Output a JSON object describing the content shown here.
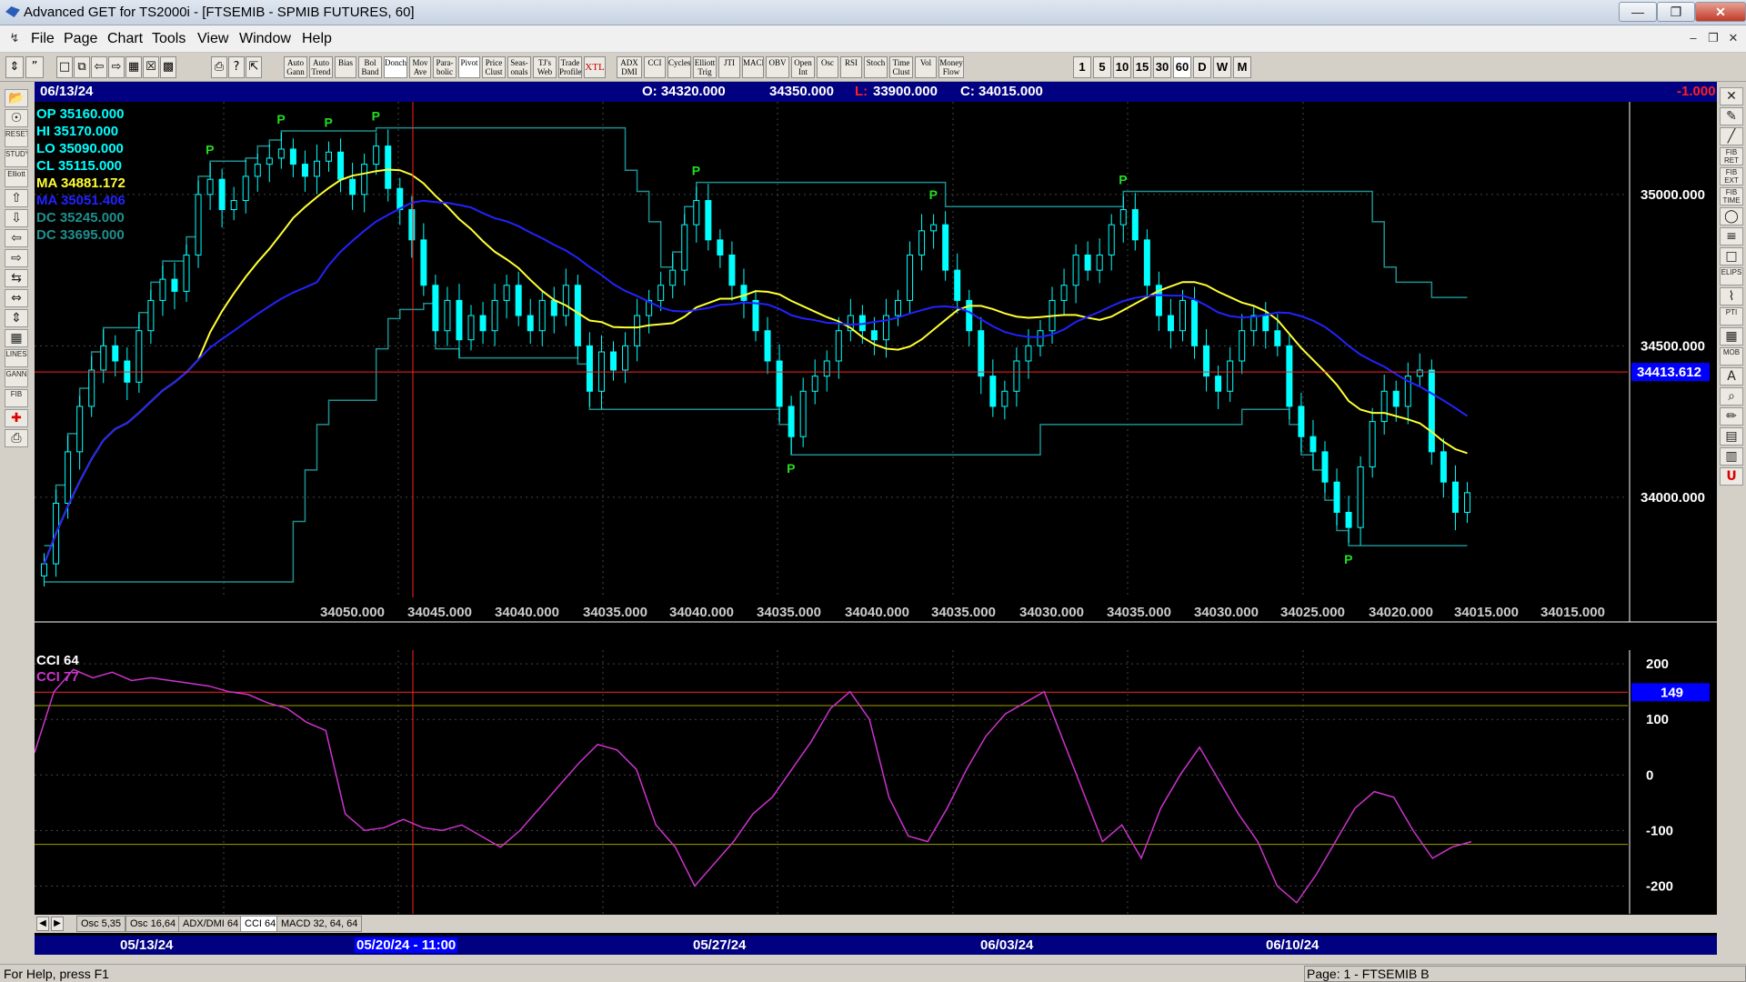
{
  "window": {
    "title": "Advanced GET for TS2000i - [FTSEMIB - SPMIB FUTURES, 60]"
  },
  "menu": [
    "File",
    "Page",
    "Chart",
    "Tools",
    "View",
    "Window",
    "Help"
  ],
  "toolbar": {
    "studies": [
      {
        "label": "Auto\nGann",
        "name": "auto-gann-button"
      },
      {
        "label": "Auto\nTrend",
        "name": "auto-trend-button"
      },
      {
        "label": "Bias",
        "name": "bias-button"
      },
      {
        "label": "Bol\nBand",
        "name": "bollinger-band-button"
      },
      {
        "label": "Donch",
        "name": "donchian-button",
        "active": true
      },
      {
        "label": "Mov\nAve",
        "name": "moving-average-button"
      },
      {
        "label": "Para-\nbolic",
        "name": "parabolic-button"
      },
      {
        "label": "Pivot",
        "name": "pivot-button",
        "active": true
      },
      {
        "label": "Price\nClust",
        "name": "price-cluster-button"
      },
      {
        "label": "Seas-\nonals",
        "name": "seasonals-button"
      },
      {
        "label": "TJ's\nWeb",
        "name": "tjs-web-button"
      },
      {
        "label": "Trade\nProfile",
        "name": "trade-profile-button"
      },
      {
        "label": "XTL",
        "name": "xtl-button",
        "xtl": true
      },
      {
        "label": "ADX\nDMI",
        "name": "adx-dmi-button"
      },
      {
        "label": "CCI",
        "name": "cci-button"
      },
      {
        "label": "Cycles",
        "name": "cycles-button"
      },
      {
        "label": "Elliott\nTrig",
        "name": "elliott-trigger-button"
      },
      {
        "label": "JTI",
        "name": "jti-button"
      },
      {
        "label": "MACD",
        "name": "macd-button"
      },
      {
        "label": "OBV",
        "name": "obv-button"
      },
      {
        "label": "Open\nInt",
        "name": "open-interest-button"
      },
      {
        "label": "Osc",
        "name": "oscillator-button"
      },
      {
        "label": "RSI",
        "name": "rsi-button"
      },
      {
        "label": "Stoch",
        "name": "stochastic-button"
      },
      {
        "label": "Time\nClust",
        "name": "time-cluster-button"
      },
      {
        "label": "Vol",
        "name": "volume-button"
      },
      {
        "label": "Money\nFlow",
        "name": "money-flow-button"
      }
    ],
    "periods": [
      "1",
      "5",
      "10",
      "15",
      "30",
      "60",
      "D",
      "W",
      "M"
    ],
    "active_period": "60"
  },
  "left_tools": [
    "open-file",
    "glasses",
    "RESET",
    "STUDY",
    "Elliott",
    "arrow-up",
    "arrow-down",
    "arrow-left",
    "arrow-right",
    "compress",
    "expand",
    "expand-vertical",
    "grid",
    "LINES",
    "GANN",
    "FIB",
    "crosshair",
    "print"
  ],
  "right_tools": [
    "cross",
    "pencil",
    "ruler",
    "FIB RET",
    "FIB EXT",
    "FIB TIME",
    "circle",
    "fan",
    "box",
    "ELIPS",
    "zigzag",
    "PTI",
    "grid",
    "MOB",
    "text",
    "zoom",
    "marker",
    "calc",
    "tablet",
    "magnet"
  ],
  "info_bar": {
    "date": "06/13/24",
    "open": "O: 34320.000",
    "high": "34350.000",
    "low_label": "L:",
    "low": "33900.000",
    "close": "C: 34015.000",
    "change": "-1.000"
  },
  "legend": {
    "op": "OP  35160.000",
    "hi": "HI   35170.000",
    "lo": "LO  35090.000",
    "cl": "CL  35115.000",
    "ma1": "MA  34881.172",
    "ma2": "MA  35051.406",
    "dc1": "DC  35245.000",
    "dc2": "DC  33695.000"
  },
  "price_axis": {
    "ticks": [
      {
        "label": "35000.000",
        "value": 35000
      },
      {
        "label": "34500.000",
        "value": 34500
      },
      {
        "label": "34000.000",
        "value": 34000
      }
    ],
    "cursor_price": "34413.612",
    "cursor_value": 34413.612,
    "ylim": [
      33600,
      35300
    ]
  },
  "bottom_ticks": [
    "34050.000",
    "34045.000",
    "34040.000",
    "34035.000",
    "34040.000",
    "34035.000",
    "34040.000",
    "34035.000",
    "34030.000",
    "34035.000",
    "34030.000",
    "34025.000",
    "34020.000",
    "34015.000",
    "34015.000"
  ],
  "pivot_label": "P",
  "cci_pane": {
    "label1": "CCI 64",
    "label2": "CCI  77",
    "ticks": [
      {
        "label": "200",
        "value": 200
      },
      {
        "label": "100",
        "value": 100
      },
      {
        "label": "0",
        "value": 0
      },
      {
        "label": "-100",
        "value": -100
      },
      {
        "label": "-200",
        "value": -200
      }
    ],
    "current": "149",
    "current_value": 149,
    "ylim": [
      -250,
      215
    ]
  },
  "tabs": [
    "Osc 5,35",
    "Osc 16,64",
    "ADX/DMI 64",
    "CCI 64",
    "MACD 32, 64, 64"
  ],
  "active_tab": "CCI 64",
  "date_axis": {
    "labels": [
      "05/13/24",
      "05/20/24 - 11:00",
      "05/27/24",
      "06/03/24",
      "06/10/24"
    ]
  },
  "status": {
    "help": "For Help, press F1",
    "page": "Page: 1 - FTSEMIB B"
  },
  "colors": {
    "background": "#000000",
    "candle": "#00ffff",
    "ma_fast": "#ffff33",
    "ma_slow": "#2222ff",
    "donchian": "#1f8f8f",
    "pivot": "#22dd22",
    "cursor": "#ff2020",
    "cci": "#cc33cc",
    "cci_band": "#a0a000",
    "info_bar": "#000080"
  },
  "chart_data": {
    "type": "candlestick",
    "symbol": "FTSEMIB - SPMIB FUTURES",
    "interval": "60",
    "close_series": [
      33780,
      33980,
      34150,
      34300,
      34420,
      34500,
      34450,
      34380,
      34550,
      34650,
      34720,
      34680,
      34800,
      35000,
      35050,
      34950,
      34980,
      35060,
      35100,
      35120,
      35150,
      35100,
      35060,
      35110,
      35140,
      35050,
      35000,
      35100,
      35160,
      35020,
      34950,
      34850,
      34700,
      34550,
      34650,
      34520,
      34600,
      34550,
      34650,
      34700,
      34600,
      34550,
      34650,
      34600,
      34700,
      34500,
      34350,
      34480,
      34420,
      34500,
      34600,
      34650,
      34700,
      34750,
      34900,
      34980,
      34850,
      34800,
      34700,
      34650,
      34550,
      34450,
      34300,
      34200,
      34350,
      34400,
      34450,
      34550,
      34600,
      34550,
      34520,
      34600,
      34650,
      34800,
      34880,
      34900,
      34750,
      34650,
      34550,
      34400,
      34300,
      34350,
      34450,
      34500,
      34550,
      34650,
      34700,
      34800,
      34750,
      34800,
      34900,
      34950,
      34850,
      34700,
      34600,
      34550,
      34650,
      34500,
      34400,
      34350,
      34450,
      34550,
      34600,
      34550,
      34500,
      34300,
      34200,
      34150,
      34050,
      33950,
      33900,
      34100,
      34250,
      34350,
      34300,
      34400,
      34420,
      34150,
      34050,
      33950,
      34015
    ],
    "ma_fast_value": 34881.172,
    "ma_slow_value": 35051.406,
    "donchian_upper": 35245.0,
    "donchian_lower": 33695.0,
    "cci_series": [
      40,
      150,
      190,
      175,
      185,
      170,
      175,
      170,
      165,
      160,
      150,
      145,
      130,
      120,
      95,
      80,
      -70,
      -100,
      -95,
      -80,
      -95,
      -100,
      -90,
      -110,
      -130,
      -100,
      -60,
      -20,
      20,
      55,
      45,
      10,
      -90,
      -130,
      -200,
      -160,
      -120,
      -70,
      -40,
      10,
      60,
      120,
      150,
      100,
      -40,
      -110,
      -120,
      -60,
      10,
      70,
      110,
      130,
      150,
      60,
      -30,
      -120,
      -90,
      -150,
      -60,
      0,
      50,
      -10,
      -70,
      -120,
      -200,
      -230,
      -180,
      -120,
      -60,
      -30,
      -40,
      -100,
      -150,
      -130,
      -120
    ],
    "cci_ylim": [
      -250,
      215
    ]
  }
}
